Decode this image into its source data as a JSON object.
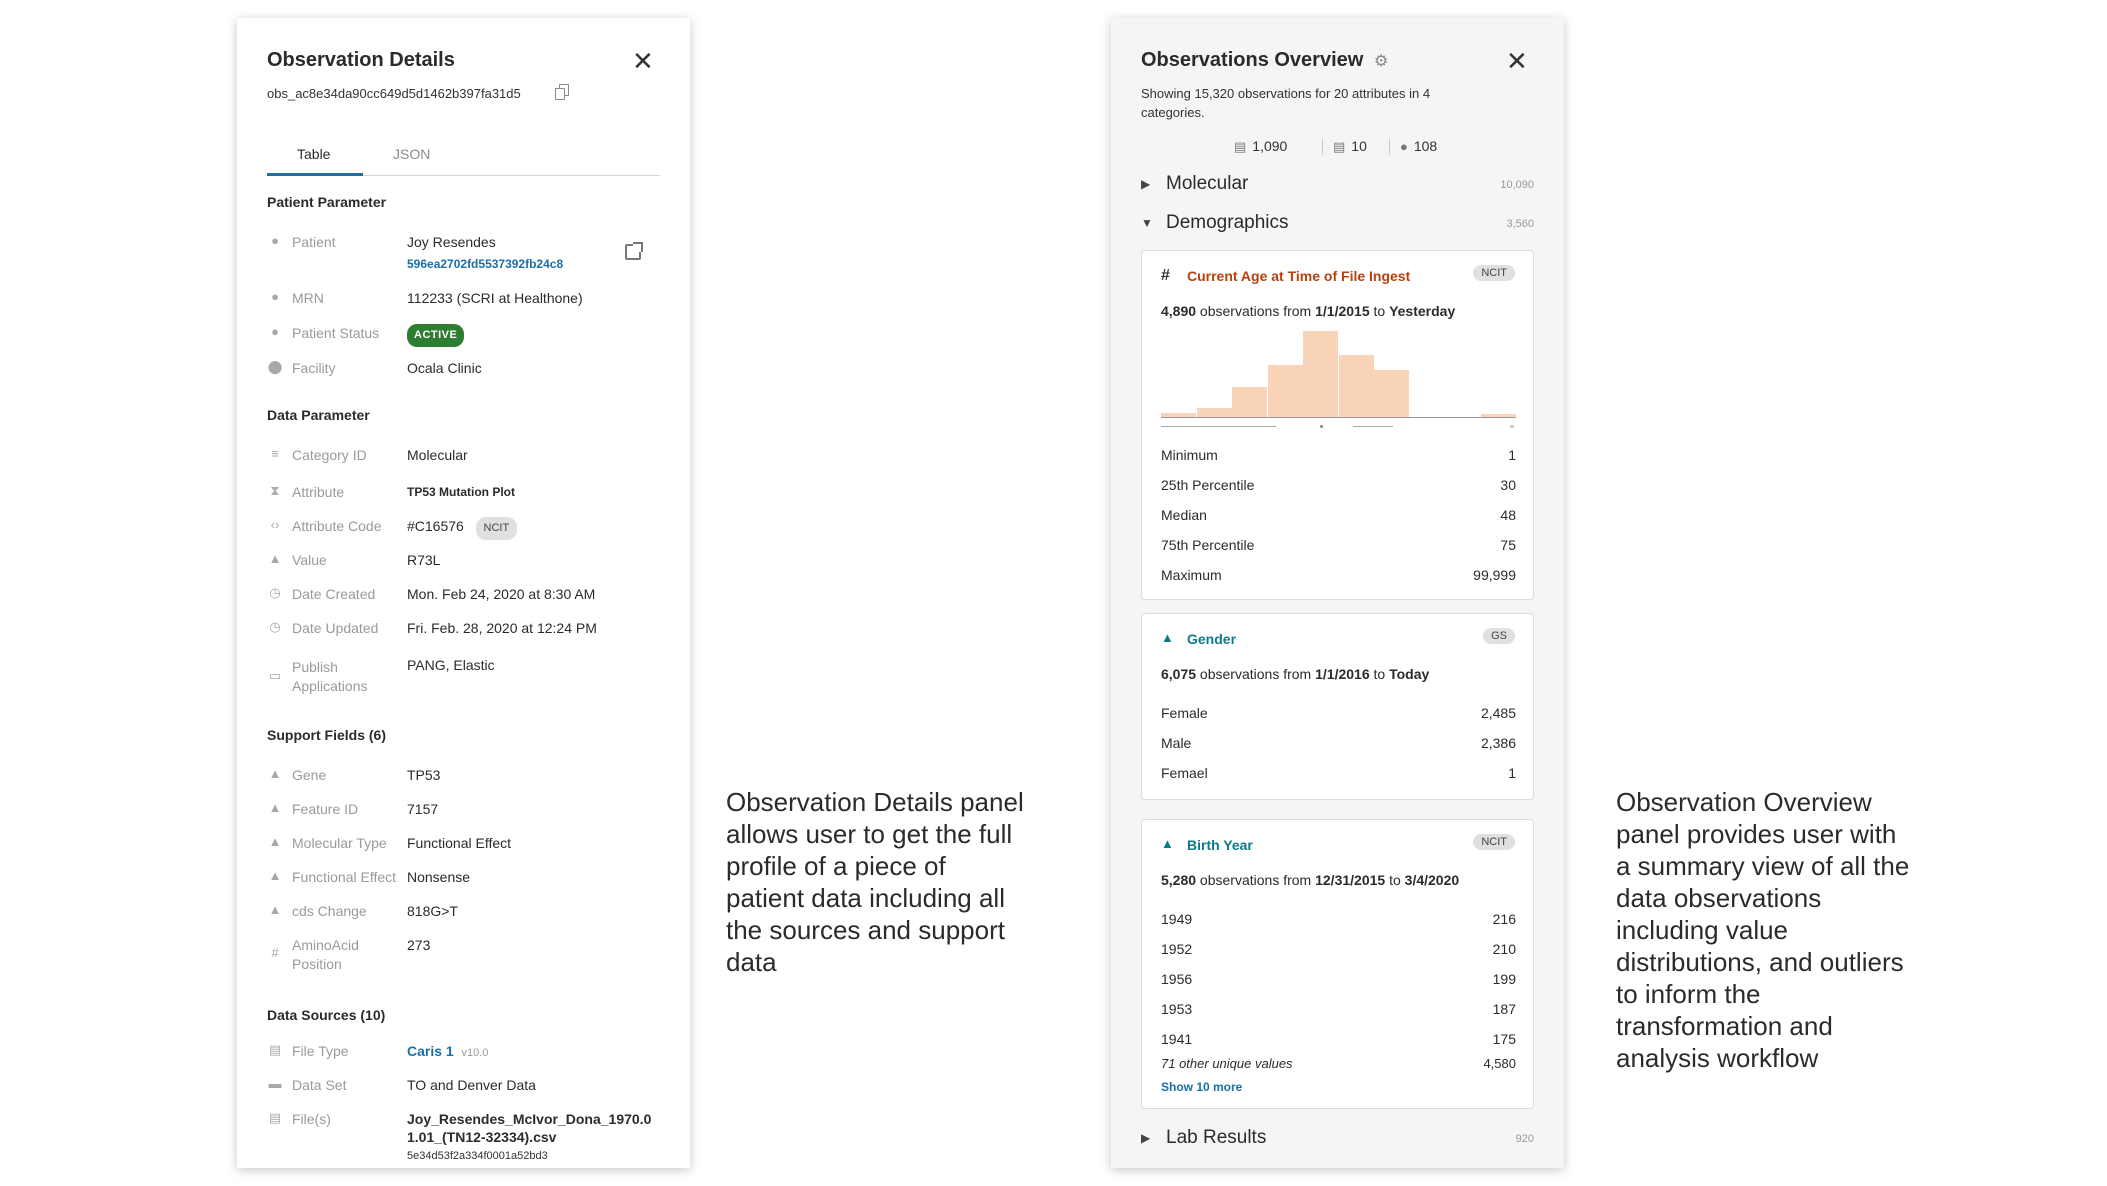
{
  "details": {
    "title": "Observation Details",
    "obs_id": "obs_ac8e34da90cc649d5d1462b397fa31d5",
    "tabs": [
      "Table",
      "JSON"
    ],
    "patient_section": "Patient Parameter",
    "patient_rows": [
      {
        "label": "Patient",
        "value": "Joy Resendes",
        "sub": "596ea2702fd5537392fb24c8"
      },
      {
        "label": "MRN",
        "value": "112233 (SCRI at Healthone)"
      },
      {
        "label": "Patient Status",
        "value": "ACTIVE"
      },
      {
        "label": "Facility",
        "value": "Ocala Clinic"
      }
    ],
    "data_section": "Data Parameter",
    "data_rows": [
      {
        "label": "Category ID",
        "value": "Molecular"
      },
      {
        "label": "Attribute",
        "value": "TP53 Mutation Plot"
      },
      {
        "label": "Attribute Code",
        "value": "#C16576",
        "tag": "NCIT"
      },
      {
        "label": "Value",
        "value": "R73L"
      },
      {
        "label": "Date Created",
        "value": "Mon. Feb 24, 2020 at 8:30 AM"
      },
      {
        "label": "Date Updated",
        "value": "Fri. Feb. 28, 2020 at 12:24 PM"
      },
      {
        "label": "Publish Applications",
        "value": "PANG, Elastic"
      }
    ],
    "support_section": "Support Fields (6)",
    "support_rows": [
      {
        "label": "Gene",
        "value": "TP53"
      },
      {
        "label": "Feature ID",
        "value": "7157"
      },
      {
        "label": "Molecular Type",
        "value": "Functional Effect"
      },
      {
        "label": "Functional Effect",
        "value": "Nonsense"
      },
      {
        "label": "cds Change",
        "value": "818G>T"
      },
      {
        "label": "AminoAcid Position",
        "value": "273"
      }
    ],
    "sources_section": "Data Sources (10)",
    "source_rows": [
      {
        "label": "File Type",
        "value": "Caris 1",
        "version": "v10.0"
      },
      {
        "label": "Data Set",
        "value": "TO and Denver Data"
      },
      {
        "label": "File(s)",
        "value": "Joy_Resendes_McIvor_Dona_1970.01.01_(TN12-32334).csv",
        "hash": "5e34d53f2a334f0001a52bd3"
      }
    ]
  },
  "annotation_left": "Observation Details panel allows user to get the full profile of a piece of patient data including all the sources and support data",
  "annotation_right": "Observation Overview panel provides user with a summary view of all the data observations including value distributions, and outliers to inform the transformation and analysis workflow",
  "overview": {
    "title": "Observations Overview",
    "subtitle": "Showing 15,320 observations for 20 attributes in 4 categories.",
    "stats": [
      "1,090",
      "10",
      "108"
    ],
    "categories": [
      {
        "name": "Molecular",
        "count": "10,090"
      },
      {
        "name": "Demographics",
        "count": "3,560"
      },
      {
        "name": "Lab Results",
        "count": "920"
      }
    ],
    "age_card": {
      "title": "Current Age at Time of File Ingest",
      "tag": "NCIT",
      "count": "4,890",
      "mid": " observations from ",
      "from": "1/1/2015",
      "to_word": " to ",
      "to": "Yesterday",
      "histogram": [
        0.05,
        0.1,
        0.35,
        0.6,
        1.0,
        0.72,
        0.55,
        0.0,
        0.0,
        0.04
      ],
      "stats": [
        {
          "k": "Minimum",
          "v": "1"
        },
        {
          "k": "25th Percentile",
          "v": "30"
        },
        {
          "k": "Median",
          "v": "48"
        },
        {
          "k": "75th Percentile",
          "v": "75"
        },
        {
          "k": "Maximum",
          "v": "99,999"
        }
      ]
    },
    "gender_card": {
      "title": "Gender",
      "tag": "GS",
      "count": "6,075",
      "mid": " observations from ",
      "from": "1/1/2016",
      "to_word": " to ",
      "to": "Today",
      "values": [
        {
          "k": "Female",
          "v": "2,485"
        },
        {
          "k": "Male",
          "v": "2,386"
        },
        {
          "k": "Femael",
          "v": "1"
        }
      ]
    },
    "birth_card": {
      "title": "Birth Year",
      "tag": "NCIT",
      "count": "5,280",
      "mid": " observations from ",
      "from": "12/31/2015",
      "to_word": " to ",
      "to": "3/4/2020",
      "values": [
        {
          "k": "1949",
          "v": "216"
        },
        {
          "k": "1952",
          "v": "210"
        },
        {
          "k": "1956",
          "v": "199"
        },
        {
          "k": "1953",
          "v": "187"
        },
        {
          "k": "1941",
          "v": "175"
        }
      ],
      "other": {
        "k": "71 other unique values",
        "v": "4,580"
      },
      "show_more": "Show 10 more"
    },
    "colors": {
      "accent": "#1a6fa8",
      "age_title": "#b5410b",
      "teal": "#0d7a88",
      "hist": "#f9d4b8"
    }
  }
}
